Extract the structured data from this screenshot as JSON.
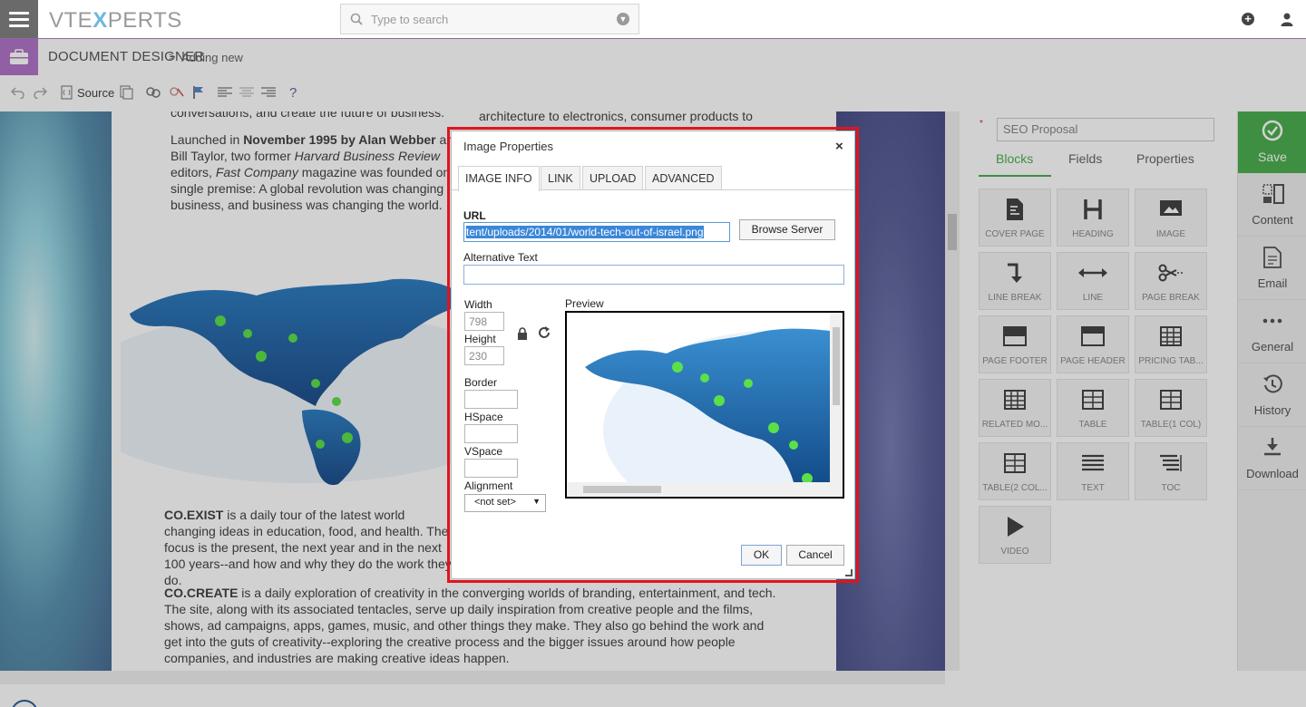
{
  "app": {
    "logo_pre": "VTE",
    "logo_x": "X",
    "logo_post": "PERTS"
  },
  "search": {
    "placeholder": "Type to search"
  },
  "breadcrumb": {
    "module": "DOCUMENT DESIGNER",
    "separator": ">",
    "page": "Adding new"
  },
  "toolbar": {
    "source_label": "Source",
    "help_label": "?"
  },
  "document": {
    "p_top_left": "conversations, and create the future of business.",
    "p_top_right": "architecture to electronics, consumer products to",
    "p_launch": [
      "Launched in ",
      "November 1995 by Alan Webber",
      " and Bill Taylor, two former ",
      "Harvard Business Review",
      " editors, ",
      "Fast Company",
      " magazine was founded on a single premise: A global revolution was changing business, and business was changing the world."
    ],
    "p_coexist_title": "CO.EXIST",
    "p_coexist": " is a daily tour of the latest world changing ideas in education, food, and health. The focus is the present, the next year and in the next 100 years--and how and why they do the work they do.",
    "p_cocreate_title": "CO.CREATE",
    "p_cocreate": " is a daily exploration of creativity in the converging worlds of branding, entertainment, and tech. The site, along with its associated tentacles, serve up daily inspiration from creative people and the films, shows, ad campaigns, apps, games, music, and other things they make. They also go behind the work and get into the guts of creativity--exploring the creative process and the bigger issues around how people companies, and industries are making creative ideas happen."
  },
  "panel": {
    "template_name": "SEO Proposal",
    "required_mark": "*",
    "tabs": [
      "Blocks",
      "Fields",
      "Properties"
    ],
    "blocks": [
      "COVER PAGE",
      "HEADING",
      "IMAGE",
      "LINE BREAK",
      "LINE",
      "PAGE BREAK",
      "PAGE FOOTER",
      "PAGE HEADER",
      "PRICING TAB...",
      "RELATED MO...",
      "TABLE",
      "TABLE(1 COL)",
      "TABLE(2 COL...",
      "TEXT",
      "TOC",
      "VIDEO"
    ]
  },
  "sidebar": {
    "save": "Save",
    "items": [
      "Content",
      "Email",
      "General",
      "History",
      "Download"
    ]
  },
  "dialog": {
    "title": "Image Properties",
    "close": "×",
    "tabs": [
      "IMAGE INFO",
      "LINK",
      "UPLOAD",
      "ADVANCED"
    ],
    "url_label": "URL",
    "url_value": "tent/uploads/2014/01/world-tech-out-of-israel.png",
    "browse_label": "Browse Server",
    "alt_label": "Alternative Text",
    "alt_value": "",
    "width_label": "Width",
    "width_value": "798",
    "height_label": "Height",
    "height_value": "230",
    "border_label": "Border",
    "hspace_label": "HSpace",
    "vspace_label": "VSpace",
    "alignment_label": "Alignment",
    "alignment_value": "<not set>",
    "preview_label": "Preview",
    "ok_label": "OK",
    "cancel_label": "Cancel"
  },
  "colors": {
    "accent_green": "#4caf50",
    "module_purple": "#b074c8",
    "highlight_red": "#e0141e",
    "selection_blue": "#3b87d9"
  }
}
